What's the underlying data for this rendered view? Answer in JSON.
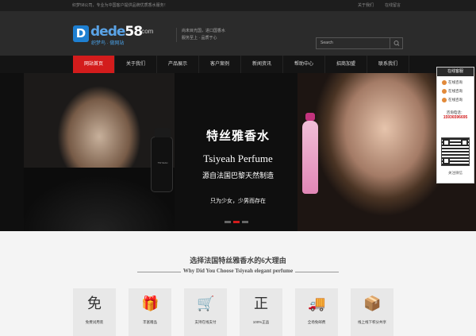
{
  "topbar": {
    "left": "织梦58公司，专业为中国客户提供品牌优质香水服务！",
    "links": [
      "关于我们",
      "在线留言"
    ]
  },
  "logo": {
    "badge": "D",
    "word": "dede",
    "accent": "58",
    "domain": ".com",
    "sub": "织梦鸟 · 做网站"
  },
  "tagline": {
    "line1": "尚未目光国，进口国香水",
    "line2": "服务至上 · 品质于心"
  },
  "search": {
    "placeholder": "Search"
  },
  "nav": [
    {
      "label": "网站首页",
      "active": true
    },
    {
      "label": "关于我们"
    },
    {
      "label": "产品展示"
    },
    {
      "label": "客户案例"
    },
    {
      "label": "新闻资讯"
    },
    {
      "label": "帮助中心"
    },
    {
      "label": "招商加盟"
    },
    {
      "label": "联系我们"
    }
  ],
  "banner": {
    "title": "特丝雅香水",
    "subtitle": "Tsiyeah Perfume",
    "line3": "源自法国巴黎天然制造",
    "line4": "只为少女，少男而存在",
    "bottle_label": "TSIYEAH"
  },
  "side": {
    "header": "在线客服",
    "services": [
      "在线咨询",
      "在线咨询",
      "在线咨询"
    ],
    "phone_label": "咨询电话：",
    "phone": "15936596695",
    "footer": "关注微信"
  },
  "why": {
    "title": "选择法国特丝雅香水的6大理由",
    "subtitle": "Why Did You Choose Tsiyeah elegant perfume"
  },
  "reasons": [
    {
      "icon": "免",
      "label": "免费试用装"
    },
    {
      "icon": "🎁",
      "label": "丰富赠品"
    },
    {
      "icon": "🛒",
      "label": "支持在线支付"
    },
    {
      "icon": "正",
      "label": "100%正品"
    },
    {
      "icon": "🚚",
      "label": "全场免邮费"
    },
    {
      "icon": "📦",
      "label": "线上线下积分共享"
    }
  ],
  "colors": {
    "accent": "#d31c1c",
    "nav": "#141414",
    "header": "#2b2b2b"
  }
}
